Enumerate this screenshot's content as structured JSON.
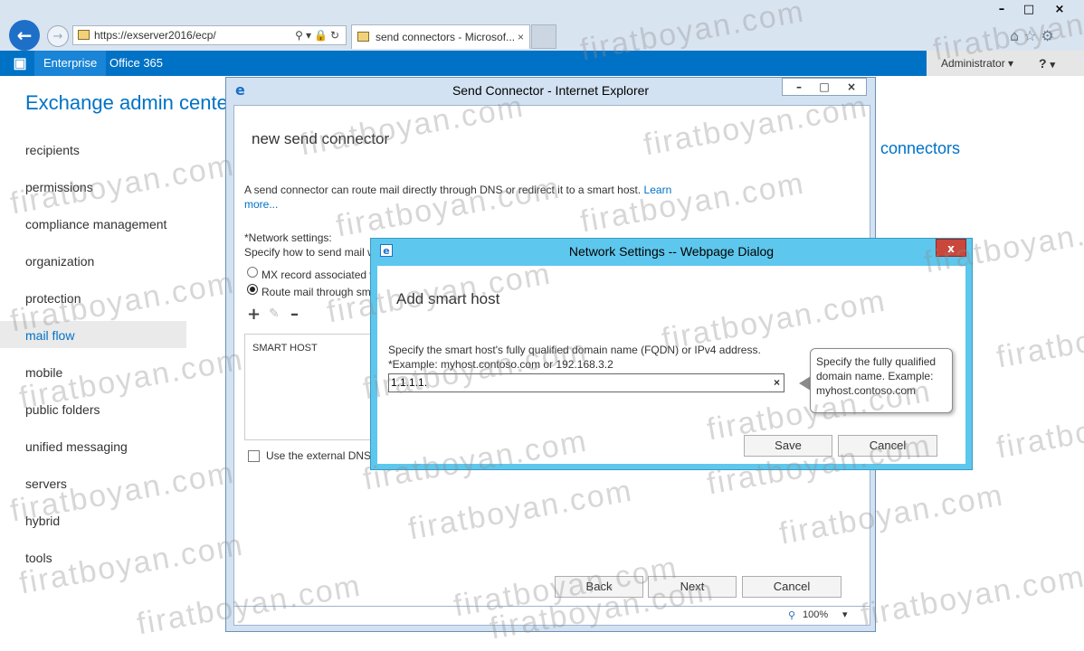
{
  "browser": {
    "address_url": "https://exserver2016/ecp/",
    "tab_label": "send connectors - Microsof...",
    "tab_close": "×",
    "controls": {
      "minimize": "–",
      "maximize": "□",
      "close": "×"
    }
  },
  "o365bar": {
    "enterprise": "Enterprise",
    "office365": "Office 365",
    "admin": "Administrator",
    "help": "?"
  },
  "eac": {
    "title": "Exchange admin cente",
    "nav": [
      "recipients",
      "permissions",
      "compliance management",
      "organization",
      "protection",
      "mail flow",
      "mobile",
      "public folders",
      "unified messaging",
      "servers",
      "hybrid",
      "tools"
    ],
    "selected_nav": "mail flow",
    "right_heading": "connectors"
  },
  "send_connector": {
    "window_title": "Send Connector - Internet Explorer",
    "heading": "new send connector",
    "description": "A send connector can route mail directly through DNS or redirect it to a smart host.",
    "learn_more": "Learn more...",
    "network_label": "*Network settings:",
    "network_desc": "Specify how to send mail w",
    "radio_mx": "MX record associated w",
    "radio_route": "Route mail through sm",
    "smart_host_header": "SMART HOST",
    "use_dns": "Use the external DNS",
    "back": "Back",
    "next": "Next",
    "cancel": "Cancel",
    "zoom": "100%"
  },
  "dialog": {
    "title": "Network Settings -- Webpage Dialog",
    "close": "x",
    "heading": "Add smart host",
    "instruction": "Specify the smart host's fully qualified domain name (FQDN) or IPv4 address.",
    "example": "*Example: myhost.contoso.com or 192.168.3.2",
    "input_value": "1.1.1.1.",
    "tooltip": "Specify the fully qualified domain name. Example: myhost.contoso.com",
    "save": "Save",
    "cancel": "Cancel"
  },
  "watermark": "firatboyan.com"
}
